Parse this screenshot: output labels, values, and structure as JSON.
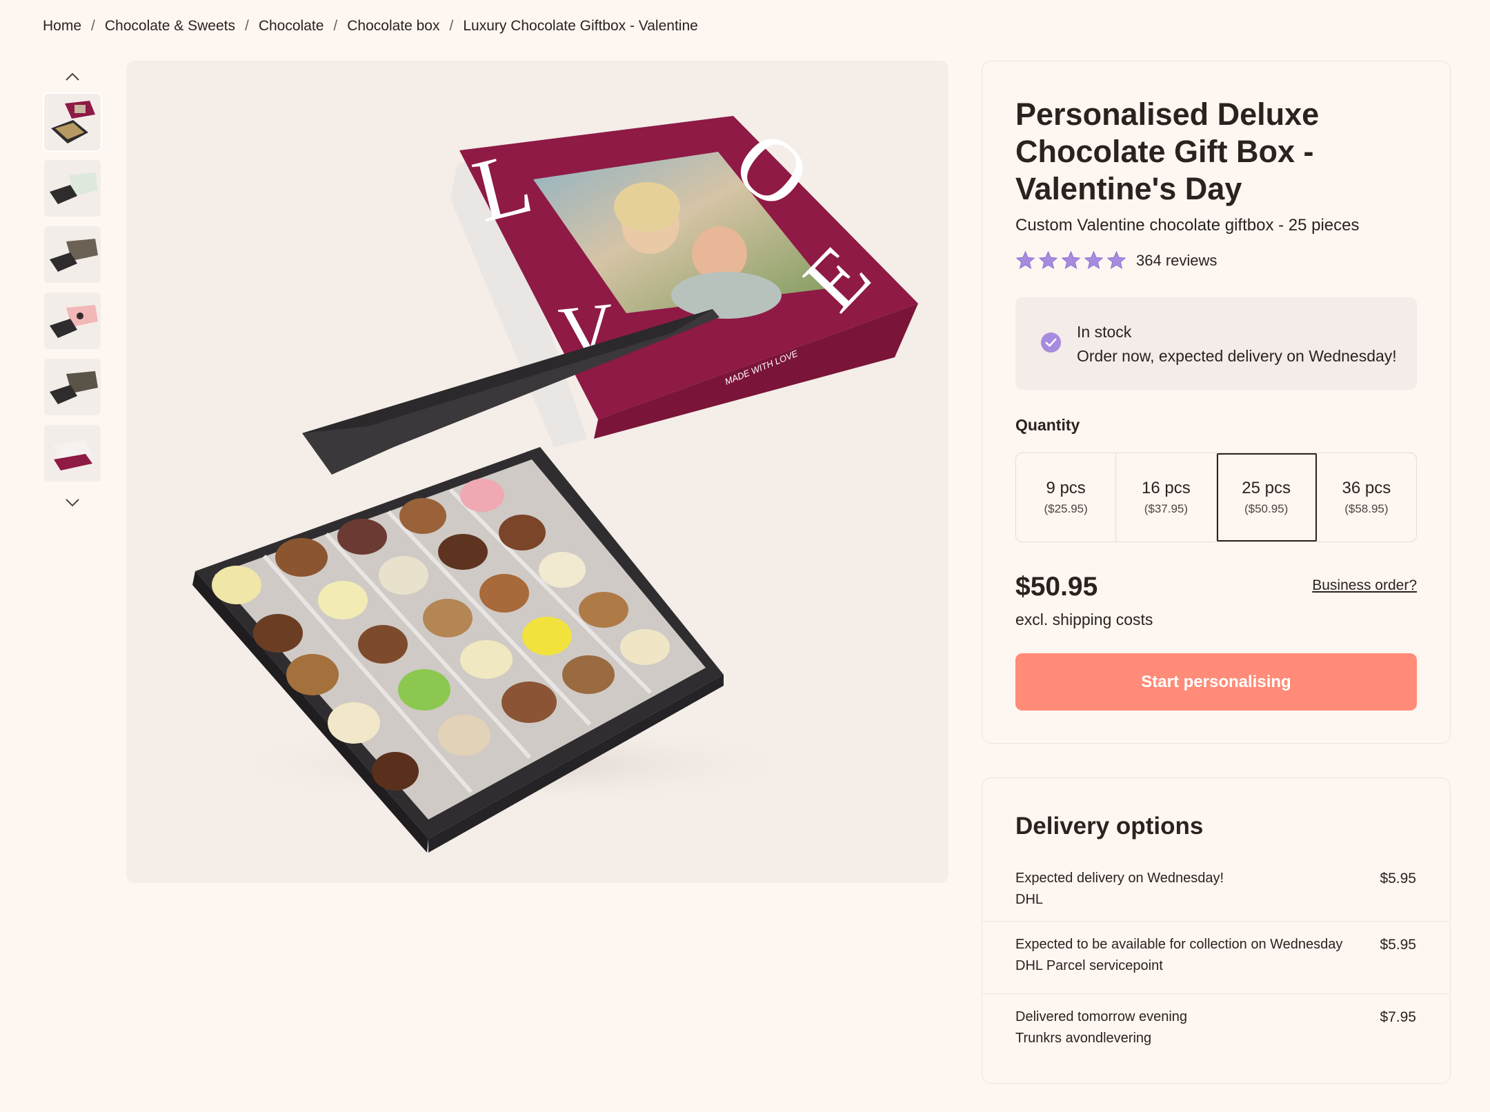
{
  "breadcrumb": [
    "Home",
    "Chocolate & Sweets",
    "Chocolate",
    "Chocolate box",
    "Luxury Chocolate Giftbox - Valentine"
  ],
  "gallery": {
    "thumbnail_count": 6,
    "active_index": 0,
    "box_text": "MADE WITH LOVE",
    "lid_letters": [
      "L",
      "O",
      "V",
      "E"
    ]
  },
  "product": {
    "title": "Personalised Deluxe Chocolate Gift Box - Valentine's Day",
    "subtitle": "Custom Valentine chocolate giftbox - 25 pieces",
    "rating": 5,
    "reviews": "364 reviews"
  },
  "stock": {
    "status": "In stock",
    "message": "Order now, expected delivery on Wednesday!"
  },
  "quantity": {
    "label": "Quantity",
    "selected": 2,
    "options": [
      {
        "name": "9 pcs",
        "price": "($25.95)"
      },
      {
        "name": "16 pcs",
        "price": "($37.95)"
      },
      {
        "name": "25 pcs",
        "price": "($50.95)"
      },
      {
        "name": "36 pcs",
        "price": "($58.95)"
      }
    ]
  },
  "pricing": {
    "price": "$50.95",
    "note": "excl. shipping costs",
    "business_link": "Business order?"
  },
  "cta_label": "Start personalising",
  "delivery": {
    "title": "Delivery options",
    "options": [
      {
        "main": "Expected delivery on Wednesday!",
        "sub": "DHL",
        "price": "$5.95"
      },
      {
        "main": "Expected to be available for collection on Wednesday",
        "sub": "DHL Parcel servicepoint",
        "price": "$5.95"
      },
      {
        "main": "Delivered tomorrow evening",
        "sub": "Trunkrs avondlevering",
        "price": "$7.95"
      }
    ]
  },
  "colors": {
    "background": "#fdf6f1",
    "accent_cta": "#ff8b78",
    "star": "#a78bdf",
    "check": "#a78bdf",
    "box_lid": "#8e1a45"
  }
}
